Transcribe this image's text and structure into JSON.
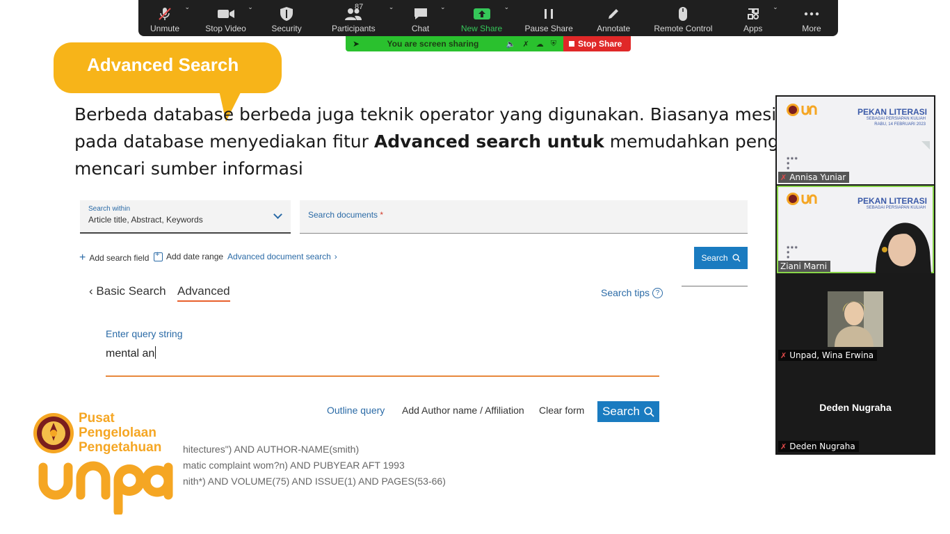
{
  "zoom_toolbar": {
    "buttons": [
      {
        "label": "Unmute",
        "icon": "mic-off-icon"
      },
      {
        "label": "Stop Video",
        "icon": "video-camera-icon"
      },
      {
        "label": "Security",
        "icon": "shield-icon"
      },
      {
        "label": "Participants",
        "icon": "participants-icon",
        "count": "87"
      },
      {
        "label": "Chat",
        "icon": "chat-icon"
      },
      {
        "label": "New Share",
        "icon": "share-screen-icon"
      },
      {
        "label": "Pause Share",
        "icon": "pause-icon"
      },
      {
        "label": "Annotate",
        "icon": "pencil-icon"
      },
      {
        "label": "Remote Control",
        "icon": "mouse-icon"
      },
      {
        "label": "Apps",
        "icon": "apps-icon"
      },
      {
        "label": "More",
        "icon": "more-dots-icon"
      }
    ],
    "share_status": "You are screen sharing",
    "stop_share": "Stop Share",
    "colors": {
      "toolbar_bg": "#1f1f1f",
      "share_green": "#2ac12e",
      "stop_red": "#e02828"
    }
  },
  "slide": {
    "bubble_title": "Advanced Search",
    "paragraph": {
      "line1": "Berbeda database berbeda juga teknik operator yang digunakan. Biasanya mesin pencari",
      "line2_pre": "pada database menyediakan fitur ",
      "line2_bold": "Advanced search untuk",
      "line2_post": " memudahkan pengguna dalam",
      "line3": "mencari sumber informasi"
    },
    "accent_color": "#f7b419"
  },
  "search_ui": {
    "search_within_label": "Search within",
    "search_within_value": "Article title, Abstract, Keywords",
    "search_documents_placeholder": "Search documents",
    "required_mark": "*",
    "add_search_field": "Add search field",
    "add_date_range": "Add date range",
    "advanced_document_search": "Advanced document search",
    "search_button": "Search",
    "basic_search": "Basic Search",
    "advanced": "Advanced",
    "search_tips": "Search tips",
    "enter_query_label": "Enter query string",
    "query_value": "mental an",
    "outline_query": "Outline query",
    "add_author": "Add Author name / Affiliation",
    "clear_form": "Clear form",
    "search_button_2": "Search",
    "examples": [
      "hitectures\") AND AUTHOR-NAME(smith)",
      "matic complaint wom?n) AND PUBYEAR AFT 1993",
      "nith*) AND VOLUME(75) AND ISSUE(1) AND PAGES(53-66)"
    ]
  },
  "logo": {
    "line1": "Pusat",
    "line2": "Pengelolaan",
    "line3": "Pengetahuan",
    "wordmark": "unpad",
    "color": "#f5a623"
  },
  "participants": [
    {
      "name": "Annisa Yuniar"
    },
    {
      "name": "Ziani Marni"
    },
    {
      "name": "Unpad, Wina Erwina"
    },
    {
      "name": "Deden Nugraha"
    }
  ],
  "mini_slide": {
    "title_line1": "PEKAN LITERASI",
    "title_line2": "SEBAGAI PERSIAPAN KULIAH",
    "date": "RABU, 14 FEBRUARI 2023"
  }
}
